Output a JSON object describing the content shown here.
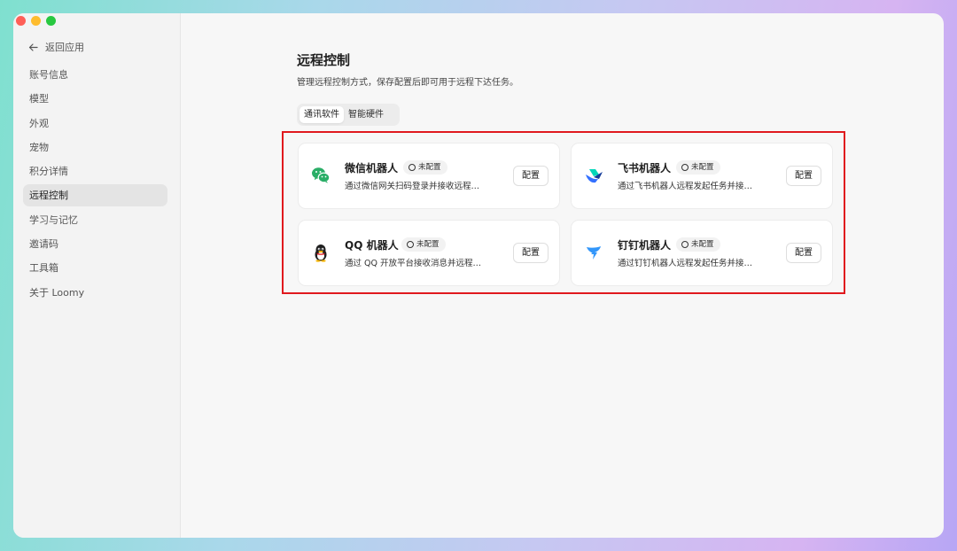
{
  "sidebar": {
    "back_label": "返回应用",
    "items": [
      {
        "label": "账号信息"
      },
      {
        "label": "模型"
      },
      {
        "label": "外观"
      },
      {
        "label": "宠物"
      },
      {
        "label": "积分详情"
      },
      {
        "label": "远程控制"
      },
      {
        "label": "学习与记忆"
      },
      {
        "label": "邀请码"
      },
      {
        "label": "工具箱"
      },
      {
        "label": "关于 Loomy"
      }
    ],
    "active_item": "远程控制"
  },
  "main": {
    "title": "远程控制",
    "subtitle": "管理远程控制方式，保存配置后即可用于远程下达任务。",
    "tabs": [
      {
        "label": "通讯软件"
      },
      {
        "label": "智能硬件"
      }
    ],
    "active_tab": "通讯软件",
    "highlight_color": "#e0191e",
    "cards": [
      {
        "icon": "wechat-icon",
        "name": "微信机器人",
        "status": "未配置",
        "description": "通过微信网关扫码登录并接收远程…",
        "button": "配置"
      },
      {
        "icon": "feishu-icon",
        "name": "飞书机器人",
        "status": "未配置",
        "description": "通过飞书机器人远程发起任务并接…",
        "button": "配置"
      },
      {
        "icon": "qq-icon",
        "name": "QQ 机器人",
        "status": "未配置",
        "description": "通过 QQ 开放平台接收消息并远程…",
        "button": "配置"
      },
      {
        "icon": "dingtalk-icon",
        "name": "钉钉机器人",
        "status": "未配置",
        "description": "通过钉钉机器人远程发起任务并接…",
        "button": "配置"
      }
    ]
  }
}
